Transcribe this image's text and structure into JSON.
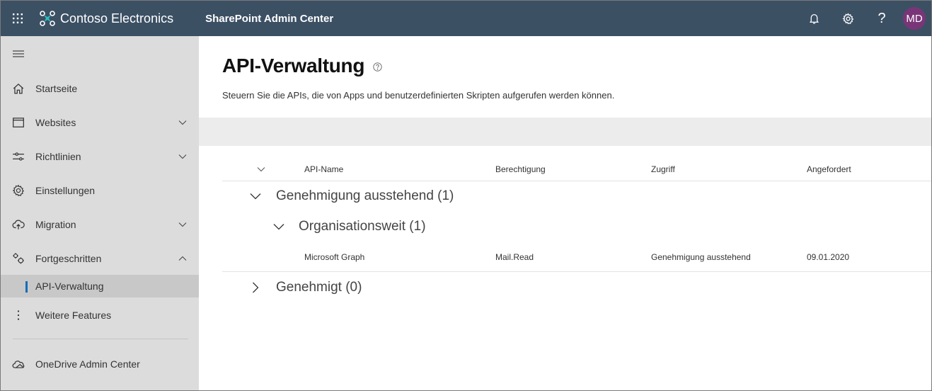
{
  "header": {
    "org_name": "Contoso Electronics",
    "app_title": "SharePoint Admin Center",
    "icons": [
      "waffle-icon",
      "contoso-logo-icon",
      "bell-icon",
      "gear-icon",
      "help-icon"
    ],
    "help_glyph": "?",
    "avatar_initials": "MD",
    "colors": {
      "bar": "#3c5064",
      "avatar": "#7a3579",
      "logo": "#2bbfbf"
    }
  },
  "sidebar": {
    "items": [
      {
        "label": "Startseite",
        "icon": "home-icon",
        "chevron": null
      },
      {
        "label": "Websites",
        "icon": "browser-window-icon",
        "chevron": "down"
      },
      {
        "label": "Richtlinien",
        "icon": "sliders-icon",
        "chevron": "down"
      },
      {
        "label": "Einstellungen",
        "icon": "gear-icon",
        "chevron": null
      },
      {
        "label": "Migration",
        "icon": "cloud-upload-icon",
        "chevron": "down"
      },
      {
        "label": "Fortgeschritten",
        "icon": "gears-icon",
        "chevron": "up"
      },
      {
        "label": "API-Verwaltung",
        "icon": null,
        "chevron": null,
        "active": true
      },
      {
        "label": "Weitere Features",
        "icon": "more-vertical-icon",
        "chevron": null
      }
    ],
    "footer_item": {
      "label": "OneDrive Admin Center",
      "icon": "onedrive-cloud-icon"
    },
    "active_color": "#0f6cbd"
  },
  "main": {
    "title": "API-Verwaltung",
    "description": "Steuern Sie die APIs, die von Apps und benutzerdefinierten Skripten aufgerufen werden können.",
    "columns": [
      "API-Name",
      "Berechtigung",
      "Zugriff",
      "Angefordert"
    ],
    "groups": [
      {
        "label": "Genehmigung ausstehend (1)",
        "expanded": true,
        "subgroups": [
          {
            "label": "Organisationsweit (1)",
            "expanded": true,
            "rows": [
              {
                "api_name": "Microsoft Graph",
                "permission": "Mail.Read",
                "access": "Genehmigung ausstehend",
                "requested": "09.01.2020"
              }
            ]
          }
        ]
      },
      {
        "label": "Genehmigt (0)",
        "expanded": false
      }
    ]
  }
}
